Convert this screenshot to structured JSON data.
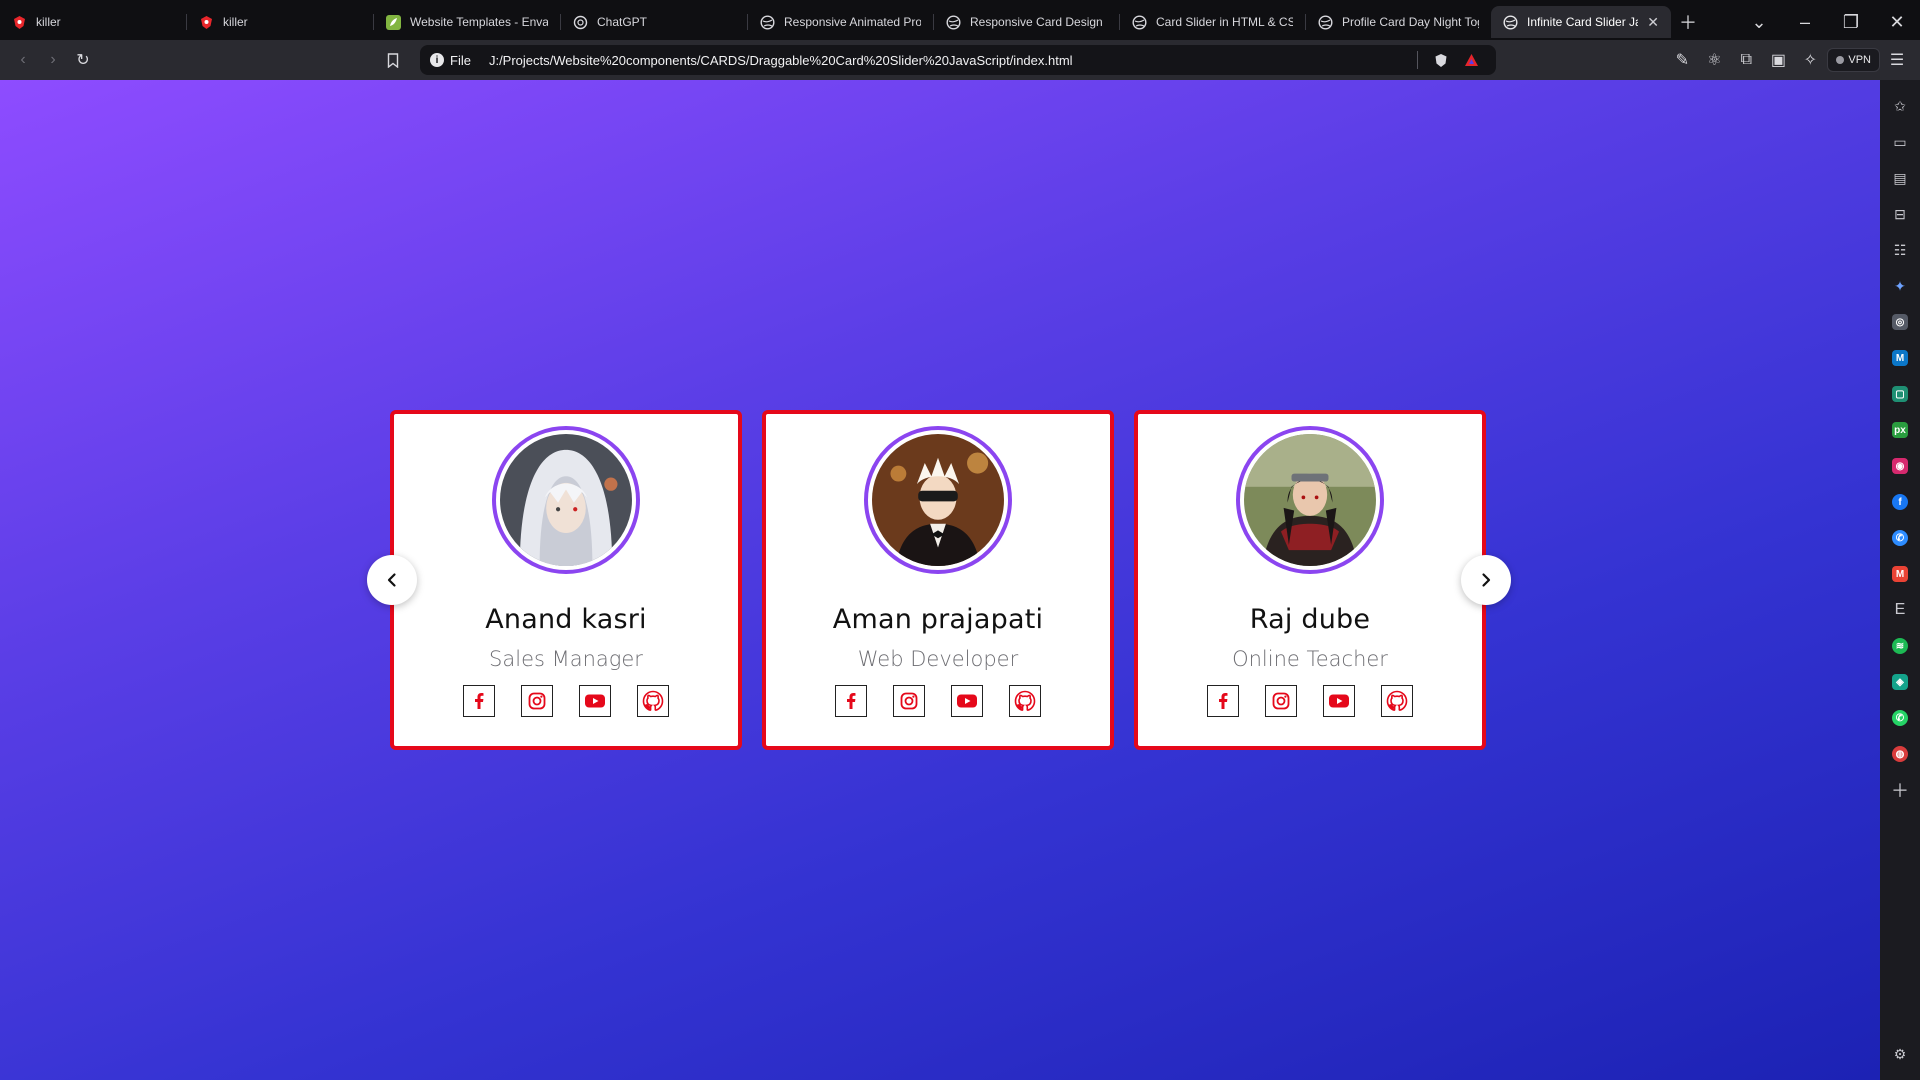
{
  "browser": {
    "tabs": [
      {
        "title": "killer",
        "icon": "brave-red-icon",
        "active": false
      },
      {
        "title": "killer",
        "icon": "brave-red-icon",
        "active": false
      },
      {
        "title": "Website Templates - Envato",
        "icon": "envato-leaf-icon",
        "active": false
      },
      {
        "title": "ChatGPT",
        "icon": "chatgpt-icon",
        "active": false
      },
      {
        "title": "Responsive Animated Profile",
        "icon": "globe-icon",
        "active": false
      },
      {
        "title": "Responsive Card Design HTML",
        "icon": "globe-icon",
        "active": false
      },
      {
        "title": "Card Slider in HTML & CSS",
        "icon": "globe-icon",
        "active": false
      },
      {
        "title": "Profile Card Day Night Toggle",
        "icon": "globe-icon",
        "active": false
      },
      {
        "title": "Infinite Card Slider JavaScript",
        "icon": "globe-icon",
        "active": true
      }
    ],
    "address": {
      "scheme_label": "File",
      "url": "J:/Projects/Website%20components/CARDS/Draggable%20Card%20Slider%20JavaScript/index.html"
    },
    "vpn_label": "VPN"
  },
  "page": {
    "cards": [
      {
        "name": "Anand kasri",
        "role": "Sales Manager",
        "avatar": "hooded-white-hair-avatar"
      },
      {
        "name": "Aman prajapati",
        "role": "Web Developer",
        "avatar": "blindfold-suit-avatar"
      },
      {
        "name": "Raj dube",
        "role": "Online Teacher",
        "avatar": "headband-ninja-avatar"
      }
    ],
    "social_icons": [
      "facebook-icon",
      "instagram-icon",
      "youtube-icon",
      "github-icon"
    ],
    "colors": {
      "card_border": "#e5081a",
      "avatar_ring": "#8b45f0",
      "social_red": "#e5081a",
      "gradient_start": "#8e4cff",
      "gradient_end": "#1c22b4"
    }
  },
  "sidebar_icons": [
    "leo-icon",
    "media-icon",
    "wallet-icon",
    "bookmarks-icon",
    "reading-list-icon",
    "ai-sparkle-icon",
    "extension-icon",
    "malwarebytes-icon",
    "notes-icon",
    "pixabay-icon",
    "instagram-icon",
    "facebook-icon",
    "messenger-icon",
    "gmail-icon",
    "envato-icon",
    "spotify-icon",
    "perplexity-icon",
    "whatsapp-icon",
    "chrome-icon",
    "add-icon",
    "settings-icon"
  ]
}
